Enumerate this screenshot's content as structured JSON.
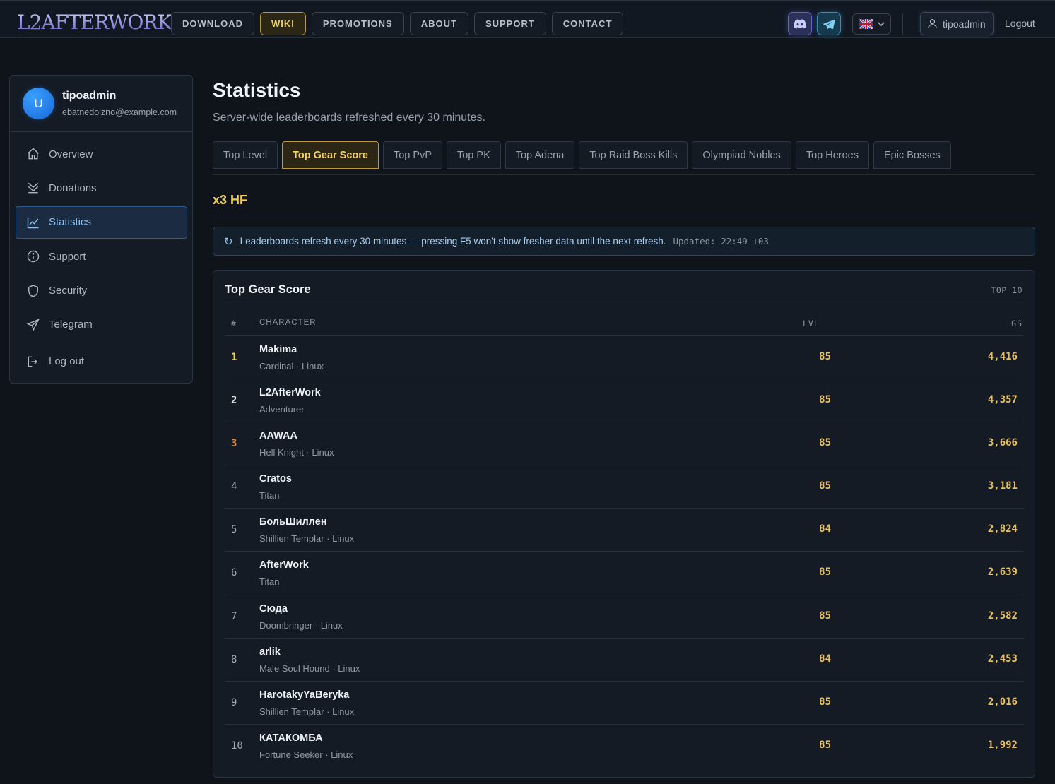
{
  "header": {
    "logo": "L2AFTERWORK",
    "nav": [
      {
        "label": "DOWNLOAD"
      },
      {
        "label": "WIKI"
      },
      {
        "label": "PROMOTIONS"
      },
      {
        "label": "ABOUT"
      },
      {
        "label": "SUPPORT"
      },
      {
        "label": "CONTACT"
      }
    ],
    "active_nav": "WIKI",
    "social": [
      "discord-icon",
      "telegram-icon"
    ],
    "language_flag": "uk-flag-icon",
    "username": "tipoadmin",
    "logout": "Logout"
  },
  "sidebar": {
    "avatar_letter": "U",
    "name": "tipoadmin",
    "email": "ebatnedolzno@example.com",
    "items": [
      {
        "label": "Overview",
        "icon": "home-icon"
      },
      {
        "label": "Donations",
        "icon": "donations-icon"
      },
      {
        "label": "Statistics",
        "icon": "chart-icon",
        "active": true
      },
      {
        "label": "Support",
        "icon": "info-icon"
      },
      {
        "label": "Security",
        "icon": "shield-icon"
      },
      {
        "label": "Telegram",
        "icon": "send-icon"
      },
      {
        "label": "Log out",
        "icon": "logout-icon"
      }
    ]
  },
  "main": {
    "title": "Statistics",
    "subtitle": "Server-wide leaderboards refreshed every 30 minutes.",
    "tabs": [
      {
        "label": "Top Level"
      },
      {
        "label": "Top Gear Score",
        "active": true
      },
      {
        "label": "Top PvP"
      },
      {
        "label": "Top PK"
      },
      {
        "label": "Top Adena"
      },
      {
        "label": "Top Raid Boss Kills"
      },
      {
        "label": "Olympiad Nobles"
      },
      {
        "label": "Top Heroes"
      },
      {
        "label": "Epic Bosses"
      }
    ],
    "server": "x3 HF",
    "notice": {
      "text": "Leaderboards refresh every 30 minutes — pressing F5 won't show fresher data until the next refresh.",
      "updated": "Updated: 22:49 +03"
    },
    "card": {
      "title": "Top Gear Score",
      "badge": "TOP 10",
      "columns": {
        "rank": "#",
        "character": "CHARACTER",
        "lvl": "LVL",
        "gs": "GS"
      },
      "rows": [
        {
          "rank": "1",
          "name": "Makima",
          "meta": "Cardinal · Linux",
          "lvl": "85",
          "gs": "4,416"
        },
        {
          "rank": "2",
          "name": "L2AfterWork",
          "meta": "Adventurer",
          "lvl": "85",
          "gs": "4,357"
        },
        {
          "rank": "3",
          "name": "AAWAA",
          "meta": "Hell Knight · Linux",
          "lvl": "85",
          "gs": "3,666"
        },
        {
          "rank": "4",
          "name": "Cratos",
          "meta": "Titan",
          "lvl": "85",
          "gs": "3,181"
        },
        {
          "rank": "5",
          "name": "БольШиллен",
          "meta": "Shillien Templar · Linux",
          "lvl": "84",
          "gs": "2,824"
        },
        {
          "rank": "6",
          "name": "AfterWork",
          "meta": "Titan",
          "lvl": "85",
          "gs": "2,639"
        },
        {
          "rank": "7",
          "name": "Сюда",
          "meta": "Doombringer · Linux",
          "lvl": "85",
          "gs": "2,582"
        },
        {
          "rank": "8",
          "name": "arlik",
          "meta": "Male Soul Hound · Linux",
          "lvl": "84",
          "gs": "2,453"
        },
        {
          "rank": "9",
          "name": "HarotakyYaBeryka",
          "meta": "Shillien Templar · Linux",
          "lvl": "85",
          "gs": "2,016"
        },
        {
          "rank": "10",
          "name": "КАТАКОМБА",
          "meta": "Fortune Seeker · Linux",
          "lvl": "85",
          "gs": "1,992"
        }
      ]
    }
  },
  "colors": {
    "accent_gold": "#f2cf56",
    "accent_blue": "#8fc3f5",
    "background": "#0f141b",
    "bronze": "#d78a4c"
  }
}
